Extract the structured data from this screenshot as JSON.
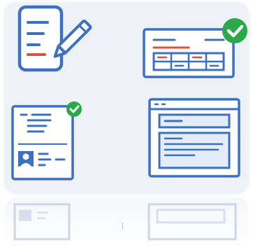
{
  "colors": {
    "accent_blue": "#3d70c0",
    "check_green": "#2aa84a",
    "red_line": "#e0503c",
    "light_blue_fill": "#e4edf9",
    "panel_bg": "#eef1f6"
  },
  "icons": [
    {
      "name": "document-edit-icon"
    },
    {
      "name": "form-table-check-icon"
    },
    {
      "name": "id-document-check-icon"
    },
    {
      "name": "browser-window-icon"
    }
  ]
}
